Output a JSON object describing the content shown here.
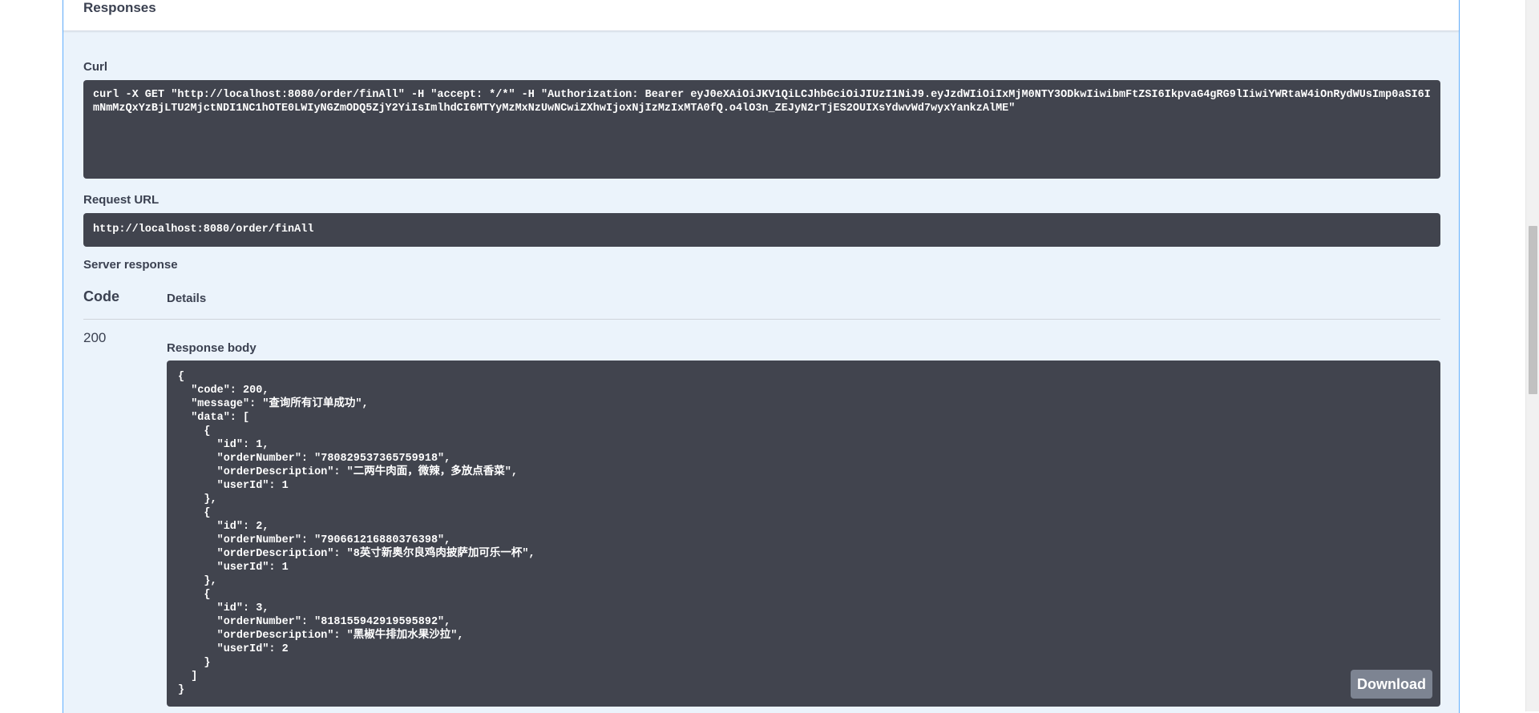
{
  "responses": {
    "title": "Responses"
  },
  "curl": {
    "label": "Curl",
    "command": "curl -X GET \"http://localhost:8080/order/finAll\" -H \"accept: */*\" -H \"Authorization: Bearer eyJ0eXAiOiJKV1QiLCJhbGciOiJIUzI1NiJ9.eyJzdWIiOiIxMjM0NTY3ODkwIiwibmFtZSI6IkpvaG4gRG9lIiwiYWRtaW4iOnRydWUsImp0aSI6ImNmMzQxYzBjLTU2MjctNDI1NC1hOTE0LWIyNGZmODQ5ZjY2YiIsImlhdCI6MTYyMzMxNzUwNCwiZXhwIjoxNjIzMzIxMTA0fQ.o4lO3n_ZEJyN2rTjES2OUIXsYdwvWd7wyxYankzAlME\""
  },
  "request_url": {
    "label": "Request URL",
    "value": "http://localhost:8080/order/finAll"
  },
  "server_response": {
    "label": "Server response",
    "code_header": "Code",
    "details_header": "Details",
    "status_code": "200",
    "body_label": "Response body",
    "body": "{\n  \"code\": 200,\n  \"message\": \"查询所有订单成功\",\n  \"data\": [\n    {\n      \"id\": 1,\n      \"orderNumber\": \"780829537365759918\",\n      \"orderDescription\": \"二两牛肉面，微辣，多放点香菜\",\n      \"userId\": 1\n    },\n    {\n      \"id\": 2,\n      \"orderNumber\": \"790661216880376398\",\n      \"orderDescription\": \"8英寸新奥尔良鸡肉披萨加可乐一杯\",\n      \"userId\": 1\n    },\n    {\n      \"id\": 3,\n      \"orderNumber\": \"818155942919595892\",\n      \"orderDescription\": \"黑椒牛排加水果沙拉\",\n      \"userId\": 2\n    }\n  ]\n}",
    "download_label": "Download"
  },
  "colors": {
    "panel_background": "#ebf3fb",
    "panel_border": "#61affe",
    "code_background": "#41444e",
    "download_button": "#7d8492",
    "text": "#3b4151"
  }
}
